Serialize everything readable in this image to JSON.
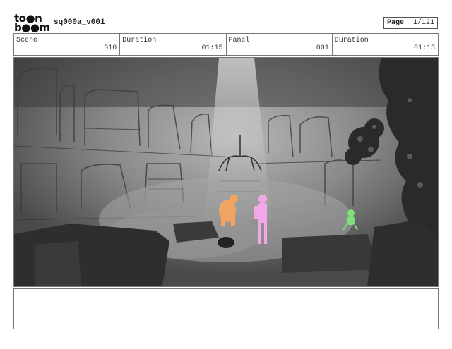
{
  "logo": {
    "line1": "to●n",
    "line2": "b●●m"
  },
  "sequence": {
    "title": "sq000a_v001"
  },
  "page": {
    "label": "Page",
    "value": "1/121"
  },
  "info": [
    {
      "label": "Scene",
      "value": "010"
    },
    {
      "label": "Duration",
      "value": "01:15"
    },
    {
      "label": "Panel",
      "value": "001"
    },
    {
      "label": "Duration",
      "value": "01:13"
    }
  ],
  "notes": {
    "text": ""
  },
  "colors": {
    "figure_orange": "#f4a460",
    "figure_pink": "#f2a8e6",
    "figure_green": "#7fe07a",
    "sketch_gray": "#5c5c5c"
  }
}
